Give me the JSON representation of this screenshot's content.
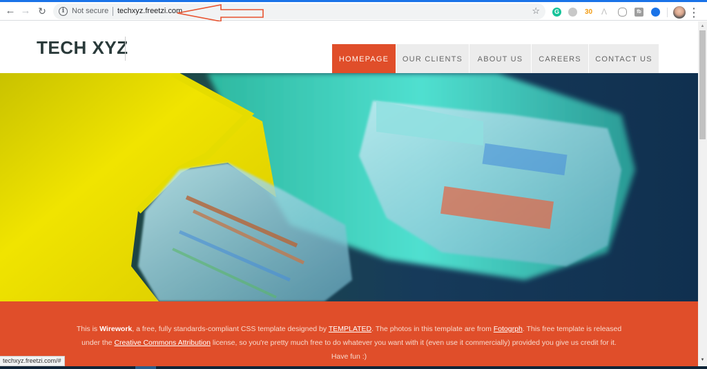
{
  "browser": {
    "address_bar": {
      "security_label": "Not secure",
      "url": "techxyz.freetzi.com",
      "info_icon": "info-icon",
      "bookmark_icon": "star-icon"
    },
    "nav_icons": [
      "back-arrow-icon",
      "forward-arrow-icon",
      "reload-icon"
    ],
    "extensions": [
      {
        "name": "grammarly-icon",
        "glyph": "G"
      },
      {
        "name": "extension-grey-circle-icon",
        "glyph": ""
      },
      {
        "name": "extension-orange-icon",
        "glyph": "30"
      },
      {
        "name": "extension-mountain-icon",
        "glyph": "Λ"
      },
      {
        "name": "extension-mouse-icon",
        "glyph": ""
      },
      {
        "name": "extension-fb-icon",
        "glyph": "fb"
      },
      {
        "name": "extension-blue-circle-icon",
        "glyph": ""
      }
    ],
    "menu_glyph": "⋮",
    "status_url": "techxyz.freetzi.com/#",
    "annotation_color": "#e8532f"
  },
  "site": {
    "logo": "TECH XYZ",
    "nav": [
      {
        "label": "HOMEPAGE",
        "active": true
      },
      {
        "label": "OUR CLIENTS",
        "active": false
      },
      {
        "label": "ABOUT US",
        "active": false
      },
      {
        "label": "CAREERS",
        "active": false
      },
      {
        "label": "CONTACT US",
        "active": false
      }
    ],
    "hero_alt": "Close-up of yellow and teal ethernet cable connectors",
    "banner": {
      "t1": "This is ",
      "wirework": "Wirework",
      "t2": ", a free, fully standards-compliant CSS template designed by ",
      "templated": "TEMPLATED",
      "t3": ". The photos in this template are from ",
      "fotogrph": "Fotogrph",
      "t4": ". This free template is released under the ",
      "cc": "Creative Commons Attribution",
      "t5": " license, so you're pretty much free to do whatever you want with it (even use it commercially) provided you give us credit for it.",
      "have_fun": "Have fun :)"
    }
  },
  "colors": {
    "accent": "#e04e2a",
    "nav_bg": "#ececec",
    "hero_bg": "#123556",
    "chrome_blue": "#1a73e8"
  }
}
